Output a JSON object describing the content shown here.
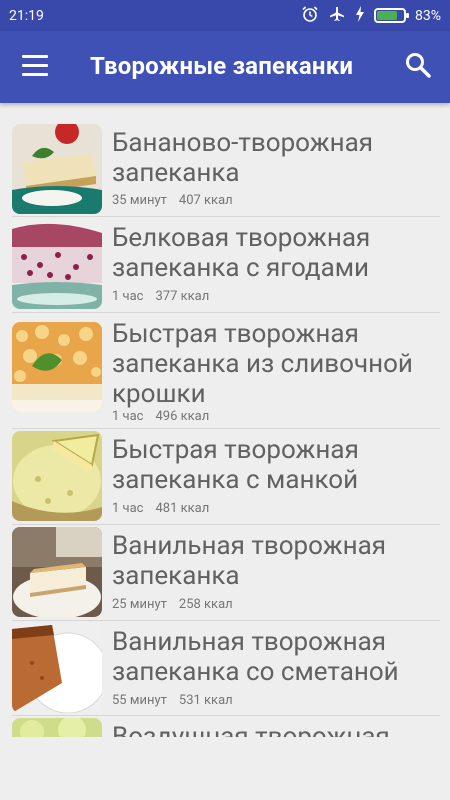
{
  "status_bar": {
    "time": "21:19",
    "icons": [
      "alarm-icon",
      "airplane-icon",
      "charging-icon",
      "battery-icon"
    ],
    "battery_percent": "83%",
    "battery_level": 0.83
  },
  "toolbar": {
    "title": "Творожные запеканки",
    "menu_icon": "hamburger-menu-icon",
    "search_icon": "search-icon",
    "color": "#3f51b5",
    "status_color": "#3949ab"
  },
  "recipes": [
    {
      "name": "Бананово-творожная запеканка",
      "time": "35 минут",
      "kcal": "407 ккал"
    },
    {
      "name": "Белковая творожная запеканка с ягодами",
      "time": "1 час",
      "kcal": "377 ккал"
    },
    {
      "name": "Быстрая творожная запеканка из сливочной крошки",
      "time": "1 час",
      "kcal": "496 ккал"
    },
    {
      "name": "Быстрая творожная запеканка с манкой",
      "time": "1 час",
      "kcal": "481 ккал"
    },
    {
      "name": "Ванильная творожная запеканка",
      "time": "25 минут",
      "kcal": "258 ккал"
    },
    {
      "name": "Ванильная творожная запеканка со сметаной",
      "time": "55 минут",
      "kcal": "531 ккал"
    },
    {
      "name": "Воздушная творожная",
      "time": "",
      "kcal": ""
    }
  ]
}
